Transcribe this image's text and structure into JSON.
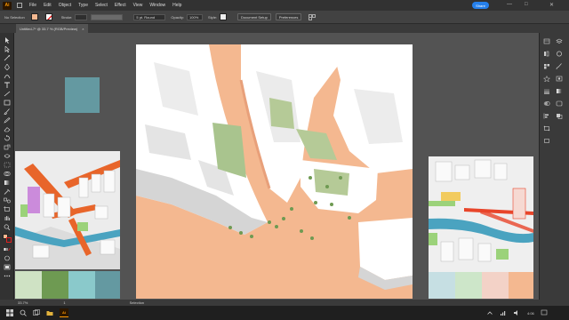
{
  "app": {
    "logo": "Ai"
  },
  "menu": {
    "items": [
      "File",
      "Edit",
      "Object",
      "Type",
      "Select",
      "Effect",
      "View",
      "Window",
      "Help"
    ]
  },
  "share_label": "Share",
  "window_controls": {
    "minimize": "—",
    "maximize": "□",
    "close": "✕"
  },
  "control_bar": {
    "selection_status": "No Selection",
    "stroke_label": "Stroke:",
    "brush_label": "5 pt. Round",
    "opacity_label": "Opacity:",
    "opacity_value": "100%",
    "style_label": "Style:",
    "document_setup": "Document Setup",
    "preferences": "Preferences",
    "fill_color": "#f4b890"
  },
  "document_tab": {
    "label": "Untitled-7* @ 33.7 % (RGB/Preview)",
    "close": "×"
  },
  "canvas": {
    "artboard_color": "#f4b890",
    "left_palette": [
      "#cfe2c4",
      "#6e9a52",
      "#8ac9cb",
      "#6499a1"
    ],
    "right_palette": [
      "#c6dfe3",
      "#cde6c9",
      "#f3d2c7",
      "#f4b890"
    ]
  },
  "status_bar": {
    "zoom": "33.7%",
    "page": "1",
    "tool": "Selection"
  },
  "taskbar": {
    "app_icon": "Ai",
    "time": "4:06"
  }
}
